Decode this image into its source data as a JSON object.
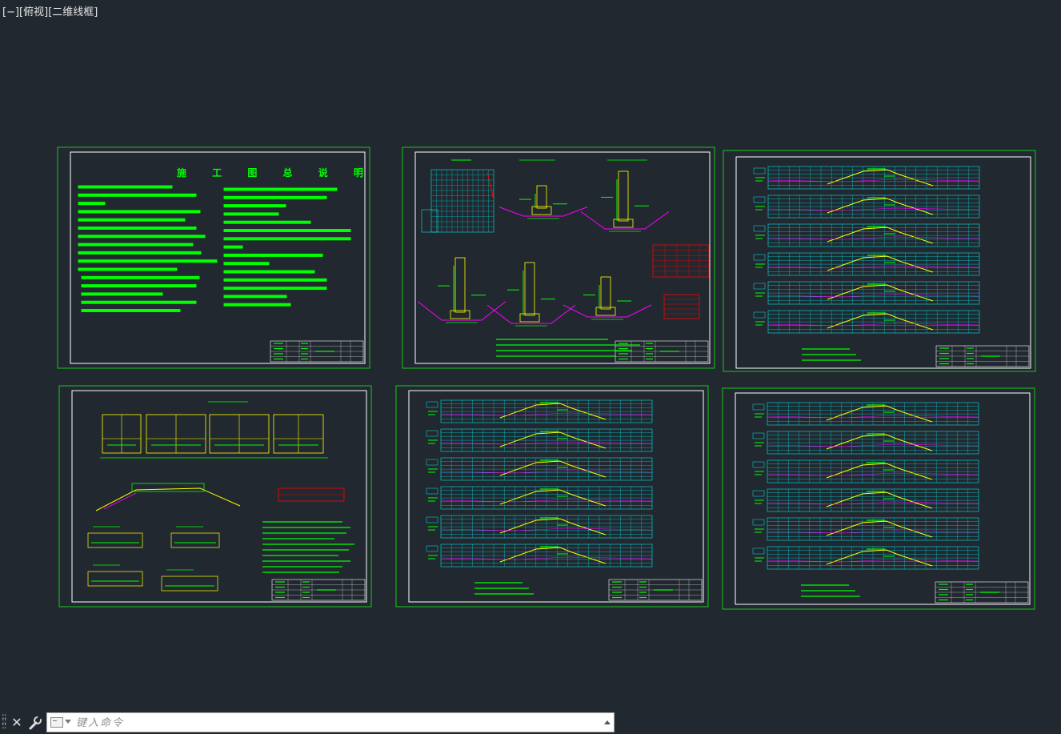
{
  "viewport": {
    "control": "[−]",
    "view": "[俯视]",
    "style": "[二维线框]"
  },
  "sheets": [
    {
      "id": "s1",
      "kind": "text",
      "title": "施 工 图 总 说 明"
    },
    {
      "id": "s2",
      "kind": "sections",
      "notes_label": "说明："
    },
    {
      "id": "s3",
      "kind": "profiles",
      "rows": 6,
      "notes_label": "说明："
    },
    {
      "id": "s4",
      "kind": "plan",
      "notes_label": "说明："
    },
    {
      "id": "s5",
      "kind": "profiles",
      "rows": 6,
      "notes_label": "说明："
    },
    {
      "id": "s6",
      "kind": "profiles",
      "rows": 6,
      "notes_label": "说明："
    }
  ],
  "colors": {
    "background": "#212830",
    "sheet_border": "#18c818",
    "frame": "#ffffff",
    "green": "#00ff00",
    "cyan": "#00e5e5",
    "yellow": "#ffff00",
    "magenta": "#ff00ff",
    "red": "#ff0000"
  },
  "command_line": {
    "placeholder": "键入命令",
    "grip_icon": "grip-icon",
    "close_icon": "close-icon",
    "customize_icon": "wrench-icon",
    "prompt_icon": "command-prompt-icon"
  }
}
